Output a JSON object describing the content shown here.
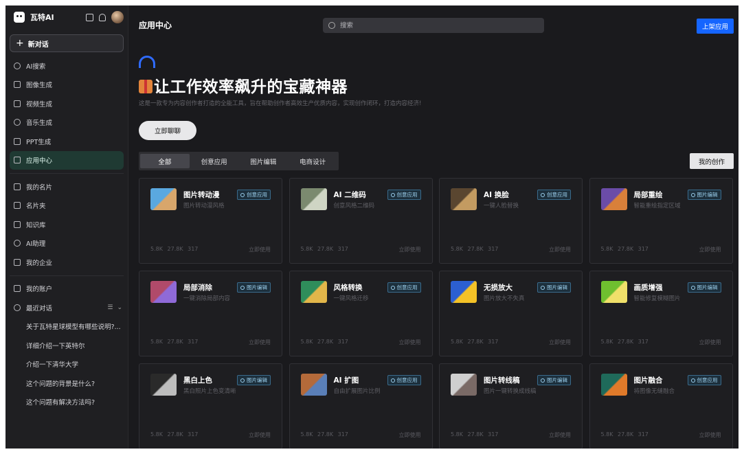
{
  "brand": {
    "name": "瓦特AI"
  },
  "sidebar": {
    "new_chat": "新对话",
    "items": [
      {
        "label": "AI搜索",
        "icon": "search-icon"
      },
      {
        "label": "图像生成",
        "icon": "image-icon"
      },
      {
        "label": "视频生成",
        "icon": "video-icon"
      },
      {
        "label": "音乐生成",
        "icon": "music-icon"
      },
      {
        "label": "PPT生成",
        "icon": "ppt-icon"
      },
      {
        "label": "应用中心",
        "icon": "app-center-icon",
        "active": true
      }
    ],
    "items2": [
      {
        "label": "我的名片",
        "icon": "card-icon"
      },
      {
        "label": "名片夹",
        "icon": "folder-icon"
      },
      {
        "label": "知识库",
        "icon": "knowledge-icon"
      },
      {
        "label": "AI助理",
        "icon": "assistant-icon"
      },
      {
        "label": "我的企业",
        "icon": "enterprise-icon"
      }
    ],
    "account": "我的账户",
    "recent": "最近对话",
    "recent_items": [
      "关于瓦特星球模型有哪些说明?...",
      "详细介绍一下英特尔",
      "介绍一下清华大学",
      "这个问题的背景是什么?",
      "这个问题有解决方法吗?"
    ]
  },
  "header": {
    "title": "应用中心",
    "search_placeholder": "搜索",
    "publish": "上架应用"
  },
  "hero": {
    "title": "让工作效率飙升的宝藏神器",
    "desc": "这是一款专为内容创作者打造的全能工具，旨在帮助创作者高效生产优质内容，实现创作闭环，打造内容经济!",
    "cta": "立即聊聊"
  },
  "tabs": [
    "全部",
    "创意应用",
    "图片编辑",
    "电商设计"
  ],
  "my_creation": "我的创作",
  "colors": {
    "accent": "#1565ff",
    "active_nav": "#1f3a33",
    "tag_text": "#9cd0ee"
  },
  "cards": [
    {
      "title": "图片转动漫",
      "sub": "图片转动漫风格",
      "tag": "创意应用",
      "views": "5.8K",
      "likes": "27.8K",
      "uses": "317",
      "action": "立即使用",
      "thumb": [
        "#5aa8e0",
        "#d8a66b"
      ]
    },
    {
      "title": "AI 二维码",
      "sub": "创意风格二维码",
      "tag": "创意应用",
      "views": "5.8K",
      "likes": "27.8K",
      "uses": "317",
      "action": "立即使用",
      "thumb": [
        "#7b8a6f",
        "#cfd5c4"
      ]
    },
    {
      "title": "AI 换脸",
      "sub": "一键人脸替换",
      "tag": "创意应用",
      "views": "5.8K",
      "likes": "27.8K",
      "uses": "317",
      "action": "立即使用",
      "thumb": [
        "#5a4630",
        "#c39b61"
      ]
    },
    {
      "title": "局部重绘",
      "sub": "智能重绘指定区域",
      "tag": "图片编辑",
      "views": "5.8K",
      "likes": "27.8K",
      "uses": "317",
      "action": "立即使用",
      "thumb": [
        "#6b4ca8",
        "#d9803a"
      ]
    },
    {
      "title": "局部消除",
      "sub": "一键消除局部内容",
      "tag": "图片编辑",
      "views": "5.8K",
      "likes": "27.8K",
      "uses": "317",
      "action": "立即使用",
      "thumb": [
        "#b04a6a",
        "#8f6ad8"
      ]
    },
    {
      "title": "风格转换",
      "sub": "一键风格迁移",
      "tag": "创意应用",
      "views": "5.8K",
      "likes": "27.8K",
      "uses": "317",
      "action": "立即使用",
      "thumb": [
        "#2f8d5b",
        "#e2b64a"
      ]
    },
    {
      "title": "无损放大",
      "sub": "图片放大不失真",
      "tag": "图片编辑",
      "views": "5.8K",
      "likes": "27.8K",
      "uses": "317",
      "action": "立即使用",
      "thumb": [
        "#2c5fd1",
        "#f4c227"
      ]
    },
    {
      "title": "画质增强",
      "sub": "智能修复模糊图片",
      "tag": "图片编辑",
      "views": "5.8K",
      "likes": "27.8K",
      "uses": "317",
      "action": "立即使用",
      "thumb": [
        "#6fbf2f",
        "#f0e06a"
      ]
    },
    {
      "title": "黑白上色",
      "sub": "黑白照片上色变清晰",
      "tag": "图片编辑",
      "views": "5.8K",
      "likes": "27.8K",
      "uses": "317",
      "action": "立即使用",
      "thumb": [
        "#2a2a2a",
        "#bdbdbd"
      ]
    },
    {
      "title": "AI 扩图",
      "sub": "自由扩展图片比例",
      "tag": "创意应用",
      "views": "5.8K",
      "likes": "27.8K",
      "uses": "317",
      "action": "立即使用",
      "thumb": [
        "#b46a3a",
        "#5a7fb8"
      ]
    },
    {
      "title": "图片转线稿",
      "sub": "图片一键转换成线稿",
      "tag": "图片编辑",
      "views": "5.8K",
      "likes": "27.8K",
      "uses": "317",
      "action": "立即使用",
      "thumb": [
        "#cfcfcf",
        "#7a6a66"
      ]
    },
    {
      "title": "图片融合",
      "sub": "将图像无缝融合",
      "tag": "创意应用",
      "views": "5.8K",
      "likes": "27.8K",
      "uses": "317",
      "action": "立即使用",
      "thumb": [
        "#1f6a5a",
        "#e07a2a"
      ]
    }
  ]
}
